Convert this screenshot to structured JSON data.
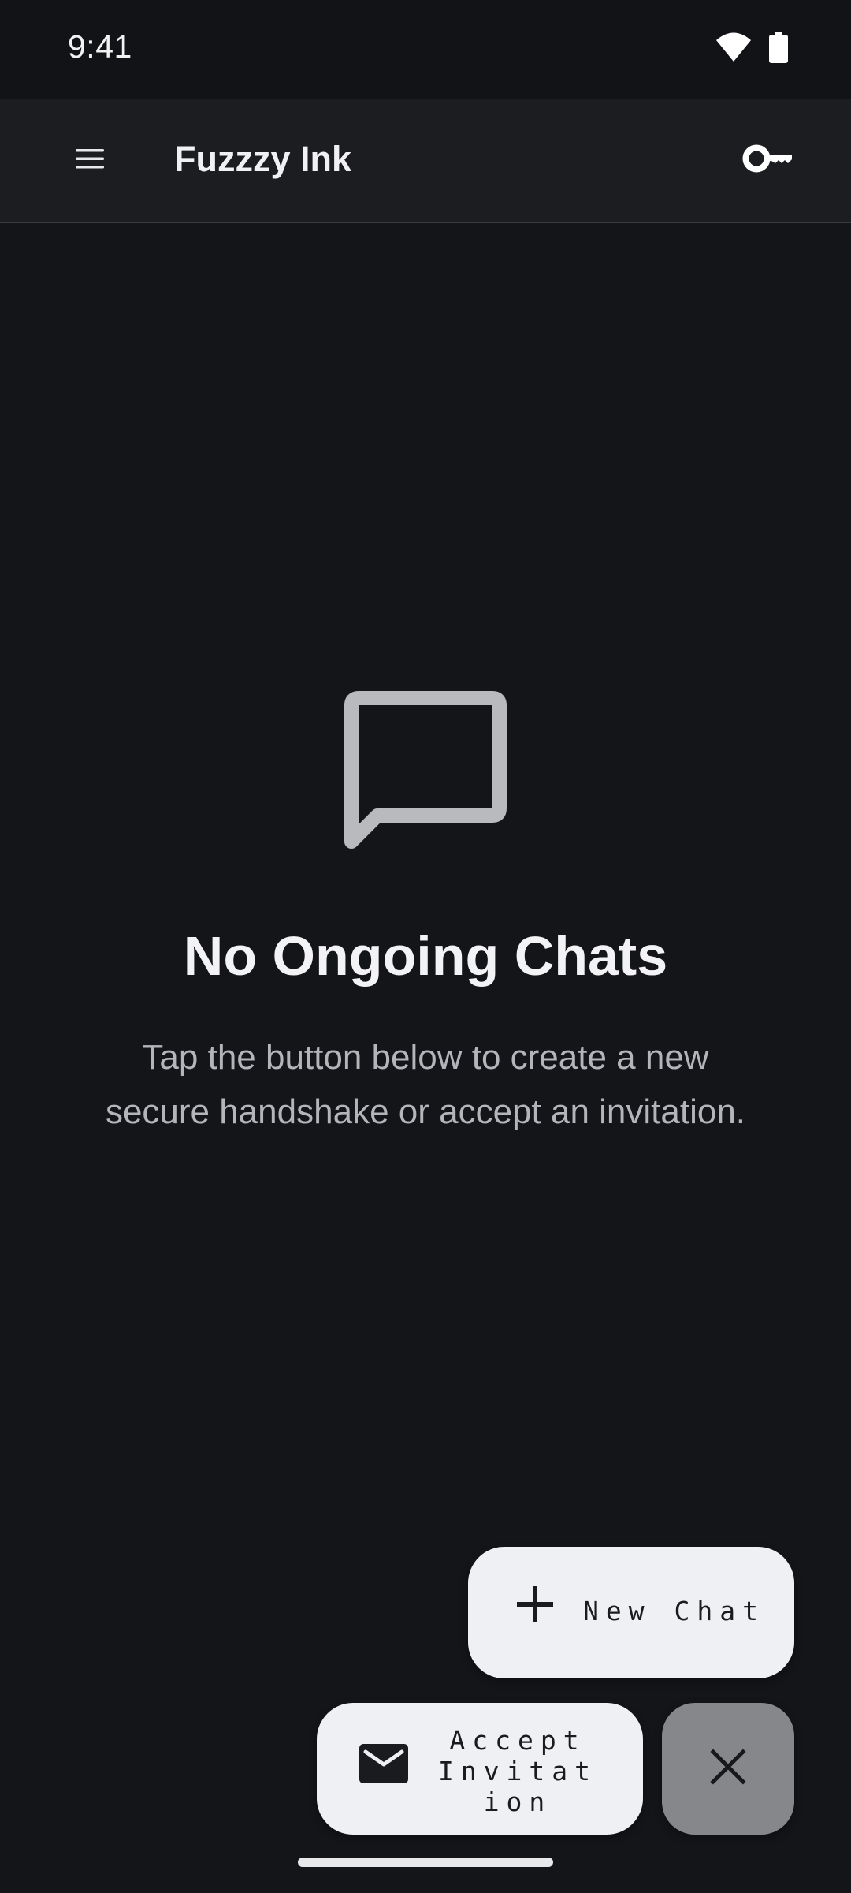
{
  "status_bar": {
    "time": "9:41",
    "icons": [
      "wifi-icon",
      "battery-icon"
    ]
  },
  "app_bar": {
    "title": "Fuzzzy Ink",
    "left_icon": "menu-icon",
    "right_icon": "key-icon"
  },
  "empty_state": {
    "icon": "chat-bubble-icon",
    "title": "No Ongoing Chats",
    "description": "Tap the button below to create a new secure handshake or accept an invitation."
  },
  "fab_menu": {
    "new_chat_label": "New Chat",
    "new_chat_icon": "plus-icon",
    "accept_label": "Accept Invitation",
    "accept_icon": "mail-icon",
    "close_icon": "close-icon"
  },
  "colors": {
    "background": "#141519",
    "app_bar": "#1c1d21",
    "fab": "#eef0f4",
    "close_fab": "#86878b",
    "muted_text": "#b4b5ba"
  }
}
